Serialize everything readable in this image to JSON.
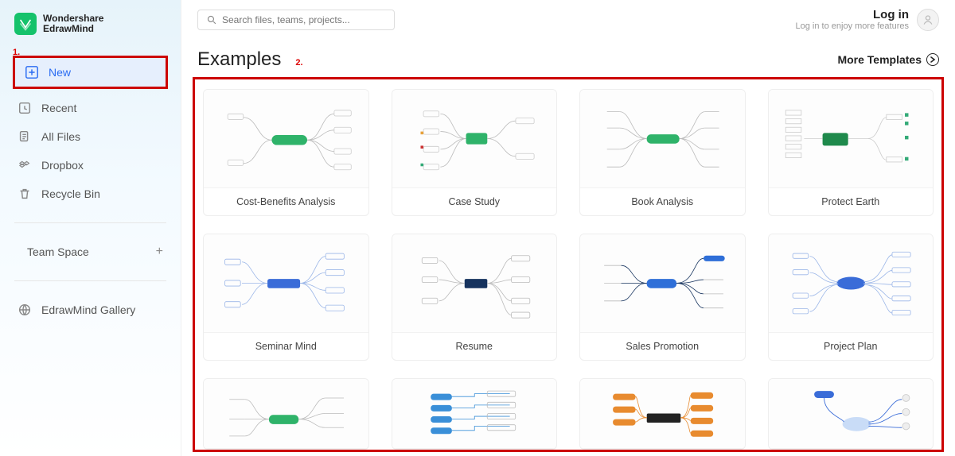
{
  "logo": {
    "line1": "Wondershare",
    "line2": "EdrawMind"
  },
  "annotations": {
    "one": "1.",
    "two": "2."
  },
  "sidebar": {
    "items": [
      {
        "label": "New"
      },
      {
        "label": "Recent"
      },
      {
        "label": "All Files"
      },
      {
        "label": "Dropbox"
      },
      {
        "label": "Recycle Bin"
      }
    ],
    "teamspace_label": "Team Space",
    "gallery_label": "EdrawMind Gallery"
  },
  "search": {
    "placeholder": "Search files, teams, projects..."
  },
  "login": {
    "title": "Log in",
    "subtitle": "Log in to enjoy more features"
  },
  "examples": {
    "heading": "Examples",
    "more_label": "More Templates",
    "cards": [
      {
        "title": "Cost-Benefits Analysis"
      },
      {
        "title": "Case Study"
      },
      {
        "title": "Book Analysis"
      },
      {
        "title": "Protect Earth"
      },
      {
        "title": "Seminar Mind"
      },
      {
        "title": "Resume"
      },
      {
        "title": "Sales Promotion"
      },
      {
        "title": "Project Plan"
      }
    ]
  }
}
